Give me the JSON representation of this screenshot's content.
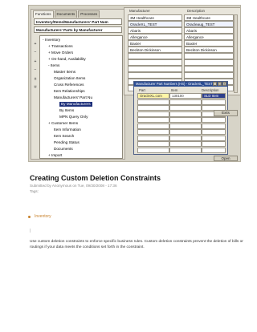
{
  "navigator": {
    "tabs": [
      "Functions",
      "Documents",
      "Processes"
    ],
    "path1": "Inventory/Items/Manufacturers' Part Num",
    "path2": "Manufacturers' Parts by Manufacturer",
    "tree": [
      {
        "label": "Inventory",
        "indent": 0,
        "bullet": "-"
      },
      {
        "label": "Transactions",
        "indent": 1,
        "bullet": "+"
      },
      {
        "label": "Move Orders",
        "indent": 1,
        "bullet": "+"
      },
      {
        "label": "On-hand, Availability",
        "indent": 1,
        "bullet": "+"
      },
      {
        "label": "Items",
        "indent": 1,
        "bullet": "-"
      },
      {
        "label": "Master Items",
        "indent": 2,
        "bullet": ""
      },
      {
        "label": "Organization Items",
        "indent": 2,
        "bullet": ""
      },
      {
        "label": "Cross References",
        "indent": 2,
        "bullet": ""
      },
      {
        "label": "Item Relationships",
        "indent": 2,
        "bullet": ""
      },
      {
        "label": "Manufacturers' Part Nu",
        "indent": 2,
        "bullet": ""
      },
      {
        "label": "By Manufacturers",
        "indent": 3,
        "bullet": "",
        "selected": true
      },
      {
        "label": "By Items",
        "indent": 3,
        "bullet": ""
      },
      {
        "label": "MPN Query Only",
        "indent": 3,
        "bullet": ""
      },
      {
        "label": "Customer Items",
        "indent": 1,
        "bullet": "+"
      },
      {
        "label": "Item Information",
        "indent": 2,
        "bullet": ""
      },
      {
        "label": "Item Search",
        "indent": 2,
        "bullet": ""
      },
      {
        "label": "Pending Status",
        "indent": 2,
        "bullet": ""
      },
      {
        "label": "Documents",
        "indent": 2,
        "bullet": ""
      },
      {
        "label": "Import",
        "indent": 1,
        "bullet": "+"
      }
    ]
  },
  "grid": {
    "col_manufacturer": "Manufacturer",
    "col_description": "Description",
    "rows": [
      {
        "manufacturer": "3M Healthcare",
        "description": "3M Healthcare"
      },
      {
        "manufacturer": "OracleXL_TEST",
        "description": "Oracleaug_TEST",
        "selected": true
      },
      {
        "manufacturer": "Abaris",
        "description": "Abaris"
      },
      {
        "manufacturer": "Allergance",
        "description": "Allergance"
      },
      {
        "manufacturer": "Baxter",
        "description": "Baxter"
      },
      {
        "manufacturer": "Beckton Dickinson",
        "description": "Beckton Dickinson"
      }
    ]
  },
  "popup": {
    "title": "Manufacturer Part Numbers (HS) - OracleXL_TEST",
    "col_part": "Part",
    "col_item": "Item",
    "col_description": "Description",
    "row": {
      "part": "OracleXL.com",
      "item": "130100",
      "description": "SLD Item"
    },
    "side_button": "Exits",
    "bottom_button": "Open"
  },
  "article": {
    "title": "Creating Custom Deletion Constraints",
    "meta": "Submitted by Anonymous on Tue, 09/30/2008 - 17:36",
    "tags_label": "Tags:",
    "tag": "Inventory",
    "separator": "|",
    "body": "Use custom deletion constraints to enforce specific business rules. Custom deletion constraints prevent the deletion of bills or routings if your data meets the conditions set forth in the constraint."
  }
}
